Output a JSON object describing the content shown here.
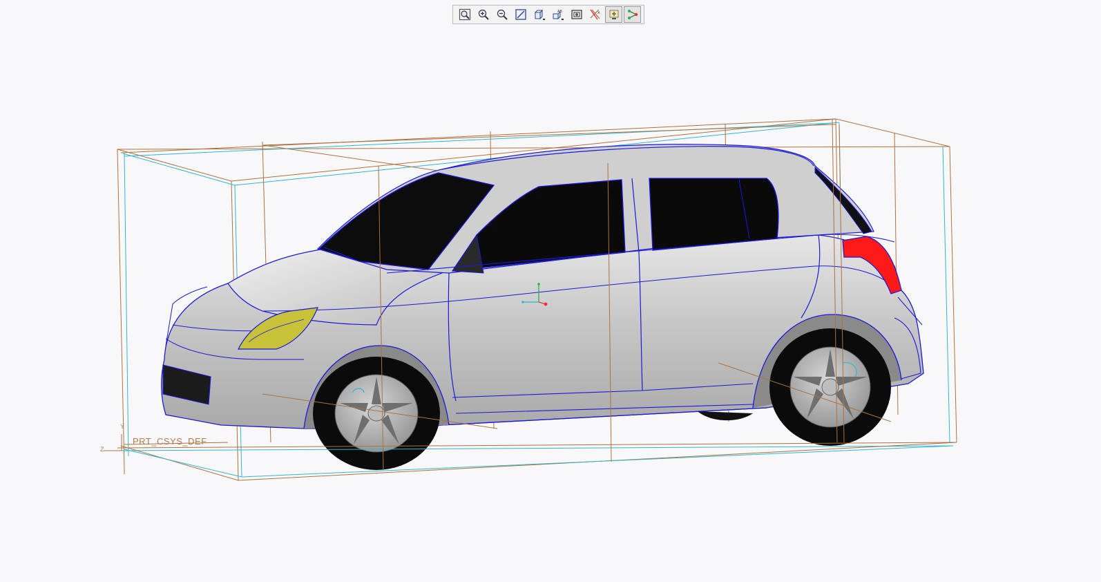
{
  "toolbar": {
    "buttons": [
      {
        "name": "refit-button",
        "icon": "zoom-fit-icon",
        "active": false
      },
      {
        "name": "zoom-in-button",
        "icon": "zoom-in-icon",
        "active": false
      },
      {
        "name": "zoom-out-button",
        "icon": "zoom-out-icon",
        "active": false
      },
      {
        "name": "repaint-button",
        "icon": "repaint-icon",
        "active": false
      },
      {
        "name": "display-style-button",
        "icon": "cube-shaded-icon",
        "active": false
      },
      {
        "name": "saved-orientations-button",
        "icon": "saved-views-icon",
        "active": false
      },
      {
        "name": "view-manager-button",
        "icon": "view-manager-icon",
        "active": false
      },
      {
        "name": "plane-display-button",
        "icon": "datum-plane-display-icon",
        "active": false
      },
      {
        "name": "csys-display-button",
        "icon": "csys-display-icon",
        "active": true
      },
      {
        "name": "point-display-button",
        "icon": "datum-point-display-icon",
        "active": true
      }
    ]
  },
  "scene": {
    "csys_label": "PRT_CSYS_DEF",
    "axis_y": "Y",
    "axis_z": "Z",
    "colors": {
      "body": "#c6c6c6",
      "edge": "#1a1ad6",
      "glass": "#0c0c0c",
      "taillight": "#ff1a1a",
      "headlight": "#c8c23a",
      "datum_brown": "#b0703c",
      "datum_cyan": "#2fb6d0"
    }
  }
}
